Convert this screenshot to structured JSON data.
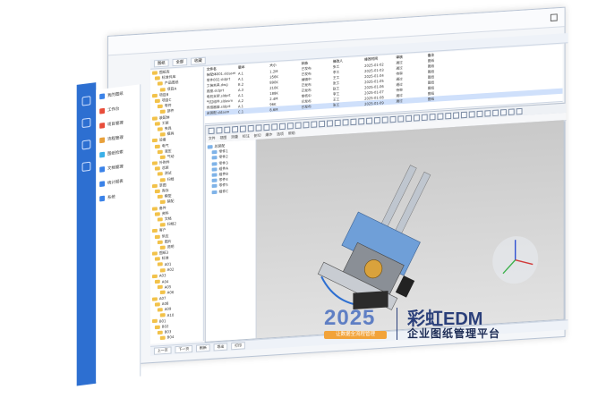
{
  "nav": {
    "items": [
      {
        "label": "我的图纸",
        "color": "#3a82e8"
      },
      {
        "label": "工作台",
        "color": "#e84d3a"
      },
      {
        "label": "项目管理",
        "color": "#e84d3a"
      },
      {
        "label": "流程管理",
        "color": "#e8a03a"
      },
      {
        "label": "图纸检索",
        "color": "#3ab0e8"
      },
      {
        "label": "文档管理",
        "color": "#3a82e8"
      },
      {
        "label": "统计报表",
        "color": "#3a82e8"
      },
      {
        "label": "系统",
        "color": "#3a82e8"
      }
    ]
  },
  "pane": {
    "tabs": [
      "图纸",
      "全部",
      "收藏"
    ]
  },
  "tree": {
    "nodes": [
      "图纸库",
      "标准件库",
      "产品图纸",
      "项目A",
      "项目B",
      "项目C",
      "零件",
      "部件",
      "装配体",
      "工装",
      "夹具",
      "模具",
      "设备",
      "电气",
      "液压",
      "气动",
      "外购件",
      "总装",
      "测试",
      "归档",
      "草图",
      "库存",
      "模型",
      "装配",
      "备件",
      "资料",
      "文档",
      "归档2",
      "客户",
      "供应",
      "图片",
      "说明",
      "图纸3",
      "标准",
      "A01",
      "A02",
      "A03",
      "A04",
      "A05",
      "A06",
      "A07",
      "A08",
      "A09",
      "A10",
      "B01",
      "B02",
      "B03",
      "B04"
    ]
  },
  "table": {
    "headers": [
      "文件名",
      "版本",
      "大小",
      "状态",
      "修改人",
      "修改时间",
      "审核",
      "备注"
    ],
    "rows": [
      [
        "装配体001.sldasm",
        "A.1",
        "1.2M",
        "已发布",
        "张工",
        "2025-01-02",
        "通过",
        "图纸"
      ],
      [
        "零件002.sldprt",
        "A.1",
        "356K",
        "已发布",
        "李工",
        "2025-01-03",
        "通过",
        "图纸"
      ],
      [
        "工装夹具.dwg",
        "B.2",
        "890K",
        "编辑中",
        "王工",
        "2025-01-04",
        "待审",
        "图纸"
      ],
      [
        "底座.sldprt",
        "A.3",
        "210K",
        "已发布",
        "张工",
        "2025-01-05",
        "通过",
        "图纸"
      ],
      [
        "电机支架.sldprt",
        "A.1",
        "188K",
        "已发布",
        "赵工",
        "2025-01-06",
        "通过",
        "图纸"
      ],
      [
        "气缸组件.sldasm",
        "A.2",
        "2.4M",
        "审核中",
        "李工",
        "2025-01-07",
        "待审",
        "图纸"
      ],
      [
        "传感器座.sldprt",
        "A.1",
        "96K",
        "已发布",
        "王工",
        "2025-01-08",
        "通过",
        "图纸"
      ],
      [
        "总装配.sldasm",
        "C.1",
        "8.6M",
        "已发布",
        "张工",
        "2025-01-09",
        "通过",
        "图纸"
      ]
    ],
    "selected_row": 7
  },
  "viewer": {
    "menu": [
      "文件",
      "视图",
      "测量",
      "标注",
      "剖切",
      "爆炸",
      "选项",
      "帮助"
    ],
    "tree": [
      "总装配",
      "零件1",
      "零件2",
      "零件3",
      "组件A",
      "组件B",
      "零件4",
      "零件5",
      "组件C"
    ]
  },
  "status": {
    "buttons": [
      "上一页",
      "下一页",
      "刷新",
      "导出",
      "打印"
    ]
  },
  "promo": {
    "year": "2025",
    "slogan": "让数据全流程管理",
    "brand": "彩虹EDM",
    "tagline": "企业图纸管理平台"
  },
  "colors": {
    "accent": "#2d6fd1",
    "brand": "#2a3f7a",
    "slogan_bg": "#f2a33a"
  }
}
